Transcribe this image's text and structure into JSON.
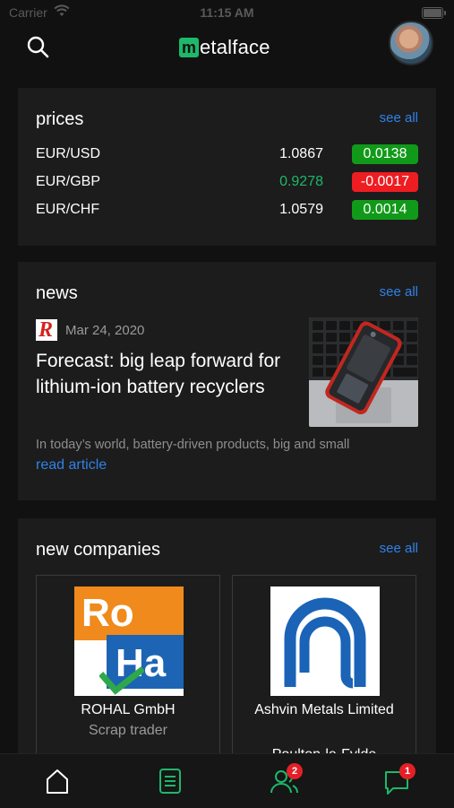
{
  "status_bar": {
    "carrier": "Carrier",
    "time": "11:15 AM"
  },
  "header": {
    "brand_initial": "m",
    "brand_name": "etalface",
    "search_icon": "search-icon",
    "avatar": "user-avatar"
  },
  "prices": {
    "title": "prices",
    "see_all": "see all",
    "rows": [
      {
        "pair": "EUR/USD",
        "value": "1.0867",
        "value_color": "#ffffff",
        "change": "0.0138",
        "change_color": "#119a19"
      },
      {
        "pair": "EUR/GBP",
        "value": "0.9278",
        "value_color": "#1db86a",
        "change": "-0.0017",
        "change_color": "#ee1d22"
      },
      {
        "pair": "EUR/CHF",
        "value": "1.0579",
        "value_color": "#ffffff",
        "change": "0.0014",
        "change_color": "#119a19"
      }
    ]
  },
  "news": {
    "title": "news",
    "see_all": "see all",
    "source_logo": "R",
    "date": "Mar 24, 2020",
    "headline": "Forecast: big leap forward for lithium-ion battery recyclers",
    "snippet": "In today’s world, battery-driven products, big and small",
    "read_more": "read article",
    "image_icon": "phone-battery-photo"
  },
  "companies": {
    "title": "new companies",
    "see_all": "see all",
    "items": [
      {
        "name": "ROHAL GmbH",
        "type": "Scrap trader",
        "location": "",
        "logo_text_1": "Ro",
        "logo_text_2": "Ha"
      },
      {
        "name": "Ashvin Metals Limited",
        "type": "",
        "location": "Poulton-le-Fylde"
      }
    ]
  },
  "tab_bar": {
    "tabs": [
      {
        "icon": "home-icon",
        "badge": ""
      },
      {
        "icon": "document-icon",
        "badge": ""
      },
      {
        "icon": "contacts-icon",
        "badge": "2"
      },
      {
        "icon": "chat-icon",
        "badge": "1"
      }
    ],
    "accent": "#1db86a"
  }
}
